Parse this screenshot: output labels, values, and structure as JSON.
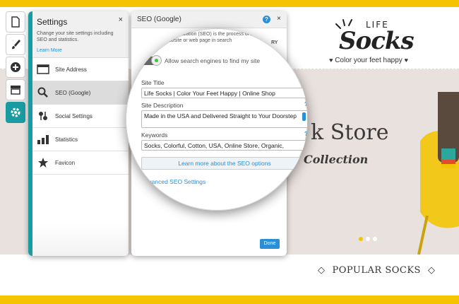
{
  "site": {
    "logo_top": "LIFE",
    "logo_main": "Socks",
    "tagline": "Color your feet happy",
    "hero_title": "k Store",
    "hero_subtitle": "Collection",
    "popular": "POPULAR SOCKS"
  },
  "toolbar": {
    "items": [
      "page-icon",
      "brush-icon",
      "add-icon",
      "store-icon",
      "gear-icon"
    ]
  },
  "settings": {
    "title": "Settings",
    "close": "×",
    "description": "Change your site settings including SEO and statistics.",
    "learn_more": "Learn More",
    "items": [
      {
        "label": "Site Address",
        "icon": "browser-window-icon"
      },
      {
        "label": "SEO (Google)",
        "icon": "magnifier-icon"
      },
      {
        "label": "Social Settings",
        "icon": "social-icon"
      },
      {
        "label": "Statistics",
        "icon": "bar-chart-icon"
      },
      {
        "label": "Favicon",
        "icon": "star-icon"
      }
    ]
  },
  "seo": {
    "title": "SEO (Google)",
    "help": "?",
    "close": "×",
    "description": "Search engine optimization (SEO) is the process of improving the visibility of a website or web page in search",
    "description_tail": "RY",
    "toggle_label": "Allow search engines to find my site",
    "site_title_label": "Site Title",
    "site_title_value": "Life Socks | Color Your Feet Happy | Online Shop",
    "site_description_label": "Site Description",
    "site_description_value": "Made in the USA and Delivered Straight to Your Doorstep",
    "keywords_label": "Keywords",
    "keywords_value": "Socks, Colorful, Cotton, USA, Online Store, Organic,",
    "learn_more_button": "Learn more about the SEO options",
    "advanced_link": "Advanced SEO Settings",
    "done_button": "Done"
  },
  "colors": {
    "brand_yellow": "#f5c400",
    "teal_accent": "#1a9ba1",
    "link_blue": "#2a8fd6"
  }
}
